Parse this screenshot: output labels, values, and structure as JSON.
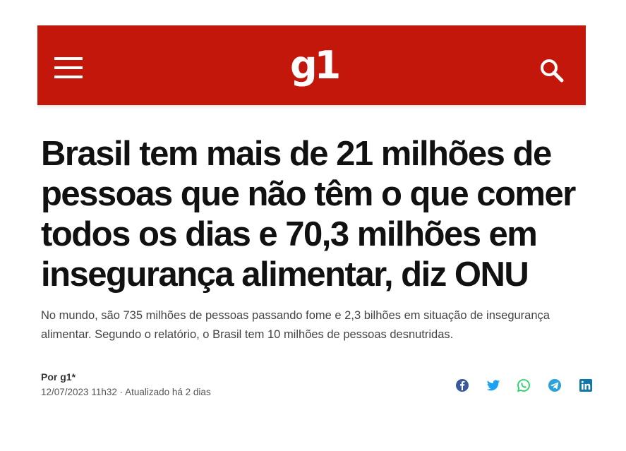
{
  "header": {
    "logo": "g1",
    "menu_icon": "hamburger-menu-icon",
    "search_icon": "search-icon",
    "bg_color": "#c4170c"
  },
  "article": {
    "headline": "Brasil tem mais de 21 milhões de pessoas que não têm o que comer todos os dias e 70,3 milhões em insegurança alimentar, diz ONU",
    "subtitle": "No mundo, são 735 milhões de pessoas passando fome e 2,3 bilhões em situação de insegurança alimentar. Segundo o relatório, o Brasil tem 10 milhões de pessoas desnutridas.",
    "byline": "Por g1*",
    "date": "12/07/2023 11h32 · Atualizado há 2 dias"
  },
  "share": [
    {
      "name": "facebook",
      "icon": "facebook-icon",
      "color": "#3b5998"
    },
    {
      "name": "twitter",
      "icon": "twitter-icon",
      "color": "#1da1f2"
    },
    {
      "name": "whatsapp",
      "icon": "whatsapp-icon",
      "color": "#25d366"
    },
    {
      "name": "telegram",
      "icon": "telegram-icon",
      "color": "#2aa1da"
    },
    {
      "name": "linkedin",
      "icon": "linkedin-icon",
      "color": "#0e76a8"
    }
  ]
}
